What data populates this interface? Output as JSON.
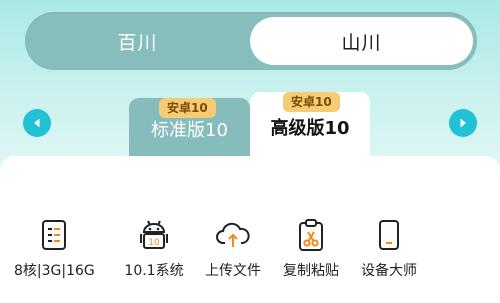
{
  "segment": {
    "left_label": "百川",
    "right_label": "山川",
    "selected": "山川"
  },
  "tabs": [
    {
      "badge": "安卓10",
      "label": "标准版10",
      "selected": false
    },
    {
      "badge": "安卓10",
      "label": "高级版10",
      "selected": true
    }
  ],
  "features": [
    {
      "icon": "spec-list-icon",
      "label": "8核|3G|16G"
    },
    {
      "icon": "android-icon",
      "label": "10.1系统"
    },
    {
      "icon": "cloud-upload-icon",
      "label": "上传文件"
    },
    {
      "icon": "clipboard-scissors-icon",
      "label": "复制粘贴"
    },
    {
      "icon": "tablet-device-icon",
      "label": "设备大师"
    }
  ],
  "colors": {
    "accent": "#22c1d6",
    "segment_bg": "#88bdbd",
    "badge": "#f6cb76",
    "icon_orange": "#f08a1c"
  }
}
